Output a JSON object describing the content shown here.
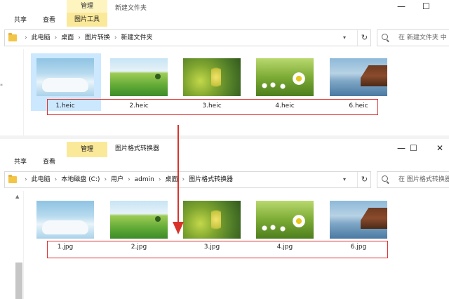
{
  "window1": {
    "title": "新建文件夹",
    "tabs": {
      "share": "共享",
      "view": "查看",
      "manage": "管理",
      "picture_tools": "图片工具"
    },
    "controls": {
      "minimize": "—",
      "maximize": "☐"
    },
    "breadcrumb": [
      "此电脑",
      "桌面",
      "图片转换",
      "新建文件夹"
    ],
    "address_dropdown": "▾",
    "refresh": "↻",
    "search_placeholder": "在 新建文件夹 中",
    "nav_marker": "*",
    "selected_index": 0,
    "files": [
      {
        "name": "1.heic",
        "thumb": "sky"
      },
      {
        "name": "2.heic",
        "thumb": "field"
      },
      {
        "name": "3.heic",
        "thumb": "blur"
      },
      {
        "name": "4.heic",
        "thumb": "daisy"
      },
      {
        "name": "6.heic",
        "thumb": "lake"
      }
    ]
  },
  "window2": {
    "title": "图片格式转换器",
    "tabs": {
      "share": "共享",
      "view": "查看",
      "manage": "管理"
    },
    "controls": {
      "minimize": "—",
      "maximize": "☐",
      "close": "✕"
    },
    "breadcrumb": [
      "此电脑",
      "本地磁盘 (C:)",
      "用户",
      "admin",
      "桌面",
      "图片格式转换器"
    ],
    "address_dropdown": "▾",
    "refresh": "↻",
    "search_placeholder": "在 图片格式转换器",
    "scroll_up": "▲",
    "files": [
      {
        "name": "1.jpg",
        "thumb": "sky"
      },
      {
        "name": "2.jpg",
        "thumb": "field"
      },
      {
        "name": "3.jpg",
        "thumb": "blur"
      },
      {
        "name": "4.jpg",
        "thumb": "daisy"
      },
      {
        "name": "6.jpg",
        "thumb": "lake"
      }
    ]
  },
  "colors": {
    "annotation_red": "#e03131",
    "context_tab": "#fbe99a",
    "selection": "#cce8ff",
    "folder": "#f3c547"
  }
}
